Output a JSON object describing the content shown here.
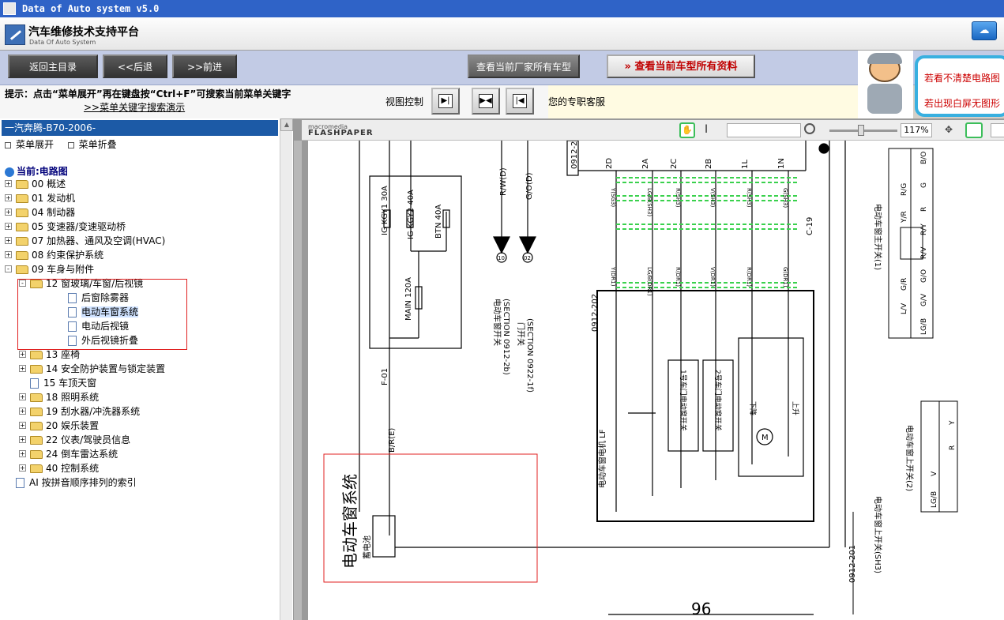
{
  "titlebar": {
    "title": "Data of Auto system v5.0"
  },
  "header": {
    "title_cn": "汽车维修技术支持平台",
    "title_en": "Data Of Auto System",
    "right_icon": "cloud-icon"
  },
  "nav": {
    "back_main": "返回主目录",
    "back": "<<后退",
    "forward": ">>前进",
    "view_manufacturer_models": "查看当前厂家所有车型",
    "view_all_model_data": "查看当前车型所有资料"
  },
  "help_bubble": {
    "line1": "若看不清楚电路图",
    "line2": "若出现白屏无图形"
  },
  "info": {
    "tip": "提示：点击“菜单展开”再在键盘按“Ctrl+F”可搜索当前菜单关键字",
    "tip_link": ">>菜单关键字搜索演示",
    "view_control_label": "视图控制",
    "service": "您的专职客服"
  },
  "sidebar": {
    "model_header": "一汽奔腾-B70-2006-",
    "expand_label": "菜单展开",
    "collapse_label": "菜单折叠",
    "current_label": "当前:电路图",
    "tree": [
      {
        "label": "00 概述",
        "type": "folder",
        "level": 0,
        "expander": "+"
      },
      {
        "label": "01 发动机",
        "type": "folder",
        "level": 0,
        "expander": "+"
      },
      {
        "label": "04 制动器",
        "type": "folder",
        "level": 0,
        "expander": "+"
      },
      {
        "label": "05 变速器/变速驱动桥",
        "type": "folder",
        "level": 0,
        "expander": "+"
      },
      {
        "label": "07 加热器、通风及空调(HVAC)",
        "type": "folder",
        "level": 0,
        "expander": "+"
      },
      {
        "label": "08 约束保护系统",
        "type": "folder",
        "level": 0,
        "expander": "+"
      },
      {
        "label": "09 车身与附件",
        "type": "folder",
        "level": 0,
        "expander": "-"
      },
      {
        "label": "12 窗玻璃/车窗/后视镜",
        "type": "folder",
        "level": 1,
        "expander": "-"
      },
      {
        "label": "后窗除雾器",
        "type": "doc",
        "level": 2
      },
      {
        "label": "电动车窗系统",
        "type": "doc",
        "level": 2,
        "selected": true
      },
      {
        "label": "电动后视镜",
        "type": "doc",
        "level": 2
      },
      {
        "label": "外后视镜折叠",
        "type": "doc",
        "level": 2
      },
      {
        "label": "13 座椅",
        "type": "folder",
        "level": 1,
        "expander": "+"
      },
      {
        "label": "14 安全防护装置与锁定装置",
        "type": "folder",
        "level": 1,
        "expander": "+"
      },
      {
        "label": "15 车顶天窗",
        "type": "doc",
        "level": 1
      },
      {
        "label": "18 照明系统",
        "type": "folder",
        "level": 1,
        "expander": "+"
      },
      {
        "label": "19 刮水器/冲洗器系统",
        "type": "folder",
        "level": 1,
        "expander": "+"
      },
      {
        "label": "20 娱乐装置",
        "type": "folder",
        "level": 1,
        "expander": "+"
      },
      {
        "label": "22 仪表/驾驶员信息",
        "type": "folder",
        "level": 1,
        "expander": "+"
      },
      {
        "label": "24 倒车雷达系统",
        "type": "folder",
        "level": 1,
        "expander": "+"
      },
      {
        "label": "40 控制系统",
        "type": "folder",
        "level": 1,
        "expander": "+"
      },
      {
        "label": "AI 按拼音顺序排列的索引",
        "type": "doc",
        "level": 0
      }
    ]
  },
  "viewer": {
    "brand_small": "macromedia",
    "brand": "FLASHPAPER",
    "zoom": "117%",
    "page_number": "96",
    "diagram": {
      "title": "电动车窗系统",
      "fuses": [
        "IG KGY1 30A",
        "IG KGY2 40A",
        "BTN 40A",
        "MAIN 120A"
      ],
      "wire_br": "B/R(E)",
      "f01": "F-01",
      "battery": "蓄电池",
      "wire_rw": "R/W(D)",
      "wire_gw": "G/O(D)",
      "conn_10": "10",
      "conn_02": "02",
      "window_sw_note_1": "电动车窗开关",
      "window_sw_note_2": "(SECTION 0912-2b)",
      "door_sw_note_1": "门开关",
      "door_sw_note_2": "(SECTION 0922-1f)",
      "sec_top": "0912-2",
      "sec_mid": "0912-202",
      "sec_bot": "0912-201",
      "c19": "C-19",
      "pins_top": [
        "2D",
        "2A",
        "2C",
        "2B",
        "1L",
        "1N"
      ],
      "wires_top": [
        "Y(SG3)",
        "LG/B(SH3)",
        "R(SH3)",
        "V(SH3)",
        "R(SH3)",
        "G(SH3)"
      ],
      "wires_bot": [
        "Y(DR1)",
        "LG/B(DR1)",
        "R(DR1)",
        "V(DR1)",
        "R(DR1)",
        "G(DR1)"
      ],
      "motor": "电动车窗电机 LF",
      "relay1": "1号车门电动窗开关",
      "relay2": "2号车门电动窗开关",
      "dn": "下降",
      "up": "上升",
      "m": "M",
      "master_sw_1": "电动车窗主开关(1)",
      "master_sw_2": "电动车窗上开关(2)",
      "master_sw_sh3": "电动车窗上开关(SH3)",
      "conn_labels_1": [
        "B/O",
        "G",
        "R/G",
        "R",
        "Y/R",
        "R/Y",
        "R/V",
        "G/O",
        "G/R",
        "G/V",
        "L/V",
        "LG/B"
      ],
      "conn_labels_2": [
        "Y",
        "R",
        "V",
        "LG/B"
      ]
    }
  }
}
